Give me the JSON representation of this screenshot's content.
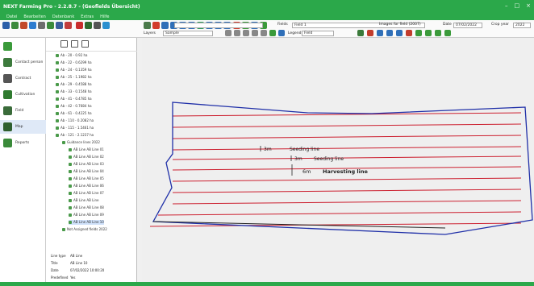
{
  "window": {
    "title": "NEXT Farming Pro - 2.2.8.7 - (Geofields Übersicht)",
    "controls": [
      "–",
      "□",
      "×"
    ]
  },
  "menu": [
    "Datei",
    "Bearbeiten",
    "Datenbank",
    "Extras",
    "Hilfe"
  ],
  "toolbar": {
    "layer_label": "Layers",
    "layer_value": "Sample",
    "zoom_value": "",
    "fields_label": "Fields",
    "fields_value": "Field 1",
    "date_label": "Date",
    "date_value": "07/02/2022",
    "year_label": "Crop year",
    "year_value": "2022",
    "legend_label": "Legend",
    "legend_value": "Field",
    "images_label": "Images for field (2007)"
  },
  "nav": [
    {
      "label": "",
      "icon": "menu-icon"
    },
    {
      "label": "Contact person",
      "icon": "contact-person-icon"
    },
    {
      "label": "Contract",
      "icon": "contract-icon"
    },
    {
      "label": "Cultivation",
      "icon": "cultivation-icon"
    },
    {
      "label": "Field",
      "icon": "field-icon"
    },
    {
      "label": "Map",
      "icon": "map-icon"
    },
    {
      "label": "Reports",
      "icon": "reports-icon"
    }
  ],
  "tree": [
    "Ab - 20 - 0.92 ha",
    "Ab - 22 - 0.6299 ha",
    "Ab - 24 - 0.1359 ha",
    "Ab - 25 - 1.1982 ha",
    "Ab - 29 - 0.4588 ha",
    "Ab - 33 - 0.1548 ha",
    "Ab - 41 - 0.4785 ha",
    "Ab - 42 - 0.7684 ha",
    "Ab - 61 - 0.4225 ha",
    "Ab - 110 - 0.2082 ha",
    "Ab - 115 - 1.5461 ha",
    "Ab - 121 - 2.1237 ha",
    "Guidance lines 2022",
    "AB Line AB Line 01",
    "AB Line AB Line 02",
    "AB Line AB Line 03",
    "AB Line AB Line 04",
    "AB Line AB Line 05",
    "AB Line AB Line 06",
    "AB Line AB Line 07",
    "AB Line AB Line",
    "AB Line AB Line 08",
    "AB Line AB Line 09",
    "AB Line AB Line 10",
    "Not Assigned fields 2022"
  ],
  "properties": [
    {
      "key": "Line type",
      "value": "AB Line"
    },
    {
      "key": "Title",
      "value": "AB Line 10"
    },
    {
      "key": "Date",
      "value": "07/02/2022 10:00:20"
    },
    {
      "key": "Predefined",
      "value": "Yes"
    }
  ],
  "map": {
    "annotations": {
      "a1": "3m",
      "a1_label": "Seeding line",
      "a2": "3m",
      "a2_label": "Seeding line",
      "a3": "6m",
      "a3_label": "Harvesting line"
    },
    "colors": {
      "field_outline": "#1f2fa8",
      "seeding_line": "#cc1f2f",
      "background": "#efefef"
    }
  }
}
